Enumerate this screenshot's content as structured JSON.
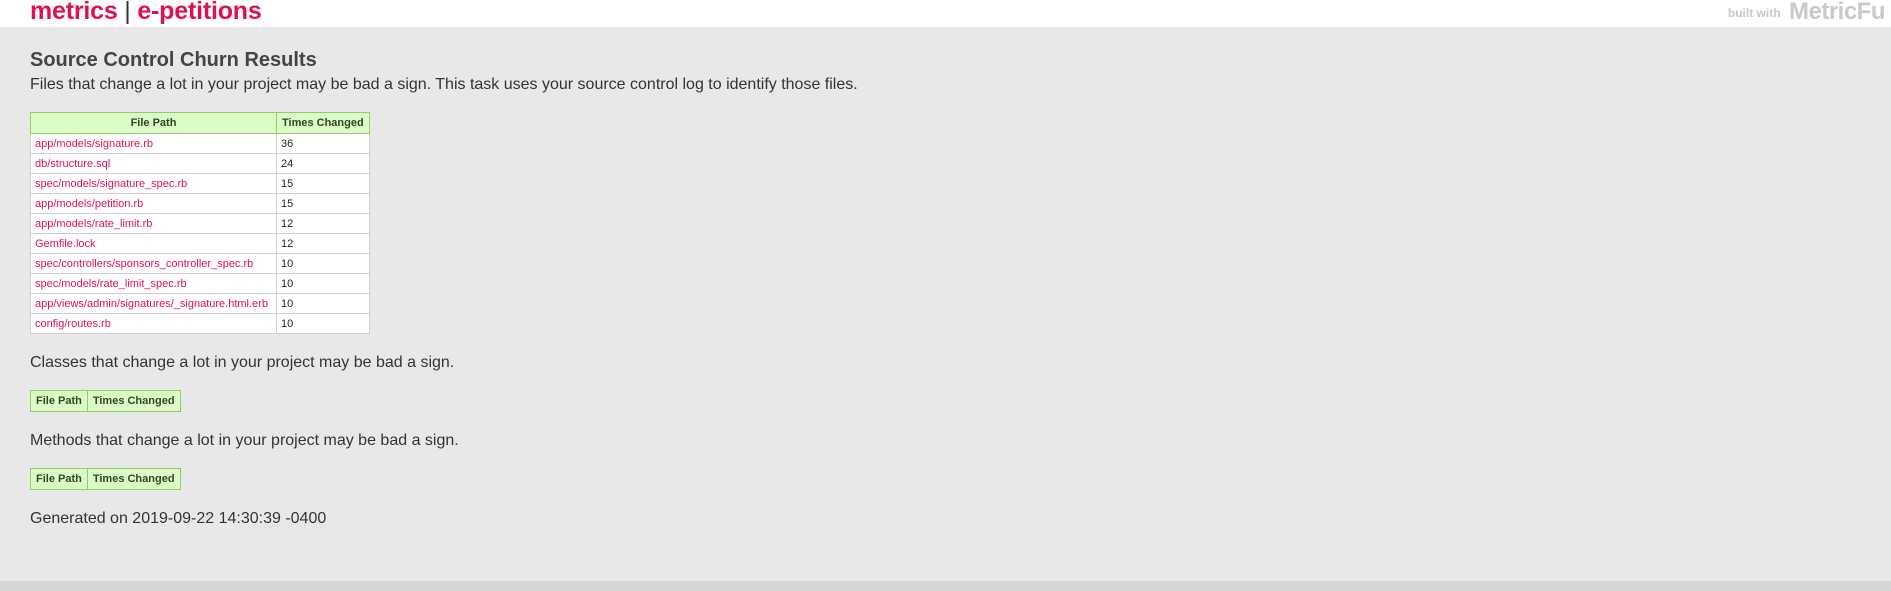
{
  "header": {
    "project_prefix": "metrics",
    "separator": "|",
    "project_name": "e-petitions",
    "built_with": "built with",
    "logo": "MetricFu"
  },
  "main": {
    "title": "Source Control Churn Results",
    "intro": "Files that change a lot in your project may be bad a sign. This task uses your source control log to identify those files.",
    "files_table": {
      "columns": [
        "File Path",
        "Times Changed"
      ],
      "rows": [
        {
          "path": "app/models/signature.rb",
          "times": "36"
        },
        {
          "path": "db/structure.sql",
          "times": "24"
        },
        {
          "path": "spec/models/signature_spec.rb",
          "times": "15"
        },
        {
          "path": "app/models/petition.rb",
          "times": "15"
        },
        {
          "path": "app/models/rate_limit.rb",
          "times": "12"
        },
        {
          "path": "Gemfile.lock",
          "times": "12"
        },
        {
          "path": "spec/controllers/sponsors_controller_spec.rb",
          "times": "10"
        },
        {
          "path": "spec/models/rate_limit_spec.rb",
          "times": "10"
        },
        {
          "path": "app/views/admin/signatures/_signature.html.erb",
          "times": "10"
        },
        {
          "path": "config/routes.rb",
          "times": "10"
        }
      ]
    },
    "classes_text": "Classes that change a lot in your project may be bad a sign.",
    "classes_table": {
      "columns": [
        "File Path",
        "Times Changed"
      ]
    },
    "methods_text": "Methods that change a lot in your project may be bad a sign.",
    "methods_table": {
      "columns": [
        "File Path",
        "Times Changed"
      ]
    },
    "generated": "Generated on 2019-09-22 14:30:39 -0400"
  },
  "colors": {
    "brand": "#e0114f",
    "header_bg": "#ffffff",
    "page_bg": "#e8e8e8",
    "table_header_bg": "#dcfcc6",
    "table_header_border": "#8fcf6b"
  }
}
